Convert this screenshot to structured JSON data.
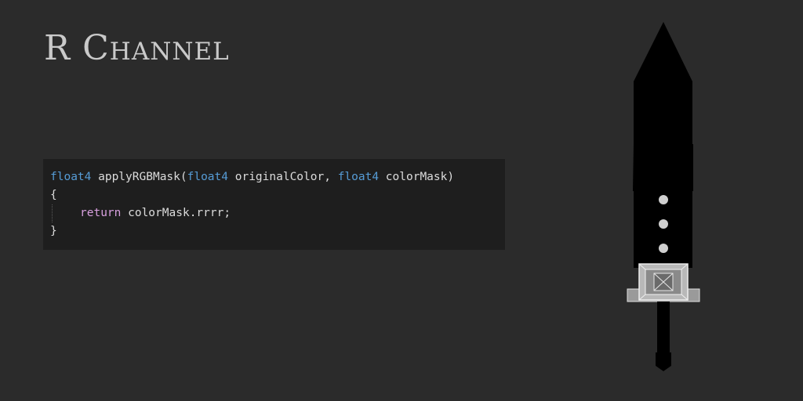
{
  "title": "R Channel",
  "code": {
    "sig_type1": "float4",
    "sig_func": " applyRGBMask(",
    "sig_type2": "float4",
    "sig_param1": " originalColor, ",
    "sig_type3": "float4",
    "sig_param2": " colorMask)",
    "open_brace": "{",
    "return_kw": "return",
    "return_expr": " colorMask.rrrr;",
    "close_brace": "}"
  },
  "colors": {
    "background": "#2b2b2b",
    "code_background": "#1e1e1e",
    "type_keyword": "#569cd6",
    "control_keyword": "#d8a0df",
    "title": "#c9c9c9"
  },
  "preview": {
    "icon": "sword-icon",
    "description_visible": false
  }
}
